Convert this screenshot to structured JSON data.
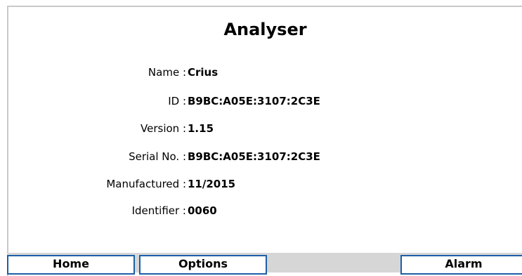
{
  "title": "Analyser",
  "fields": [
    {
      "label": "Name :",
      "value": "Crius"
    },
    {
      "label": "ID :",
      "value": "B9BC:A05E:3107:2C3E"
    },
    {
      "label": "Version :",
      "value": "1.15"
    },
    {
      "label": "Serial No. :",
      "value": "B9BC:A05E:3107:2C3E"
    },
    {
      "label": "Manufactured :",
      "value": "11/2015"
    },
    {
      "label": "Identifier :",
      "value": "0060"
    }
  ],
  "toolbar": {
    "home_label": "Home",
    "options_label": "Options",
    "alarm_label": "Alarm"
  },
  "colors": {
    "button_border": "#1d5fa8",
    "toolbar_background": "#d6d6d6",
    "frame_border": "#c9c9c9"
  }
}
